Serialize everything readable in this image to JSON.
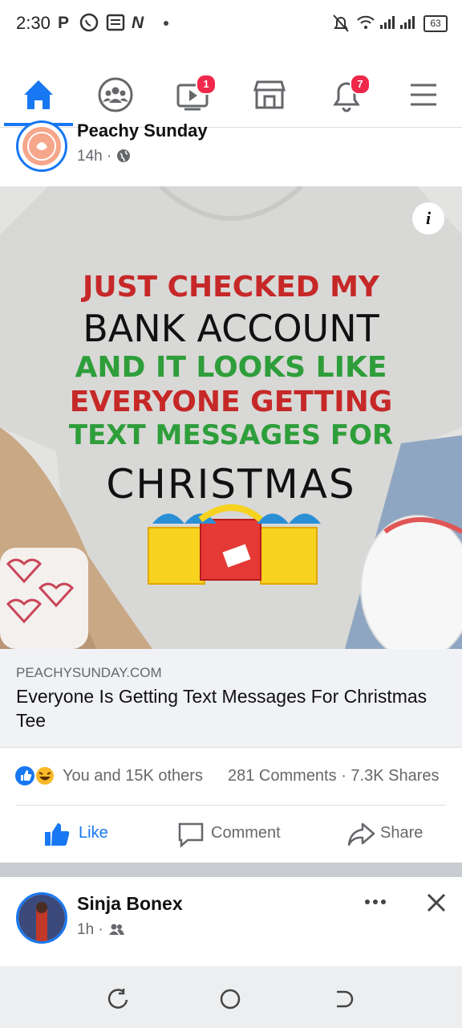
{
  "status_bar": {
    "time": "2:30",
    "notif_icons": [
      "P",
      "N"
    ],
    "battery": "63"
  },
  "nav": {
    "items": [
      "home-icon",
      "groups-icon",
      "watch-icon",
      "marketplace-icon",
      "notifications-icon",
      "menu-icon"
    ],
    "watch_badge": "1",
    "notifications_badge": "7"
  },
  "post": {
    "page_name": "Peachy Sunday",
    "time": "14h",
    "meta_separator": "·",
    "image": {
      "info_label": "i",
      "lines": [
        "JUST CHECKED MY",
        "BANK ACCOUNT",
        "AND IT LOOKS LIKE",
        "EVERYONE GETTING",
        "TEXT MESSAGES FOR",
        "CHRISTMAS"
      ]
    },
    "link": {
      "domain": "PEACHYSUNDAY.COM",
      "title": "Everyone Is Getting Text Messages For Christmas Tee"
    },
    "reactions_text": "You and 15K others",
    "comments": "281 Comments",
    "separator": "·",
    "shares": "7.3K Shares",
    "actions": {
      "like": "Like",
      "comment": "Comment",
      "share": "Share"
    }
  },
  "next_post": {
    "author": "Sinja Bonex",
    "time": "1h",
    "meta_separator": "·"
  },
  "colors": {
    "brand_blue": "#1877f2",
    "badge_red": "#f02849",
    "shirt_red": "#c62828",
    "shirt_green": "#2e9e3a"
  }
}
